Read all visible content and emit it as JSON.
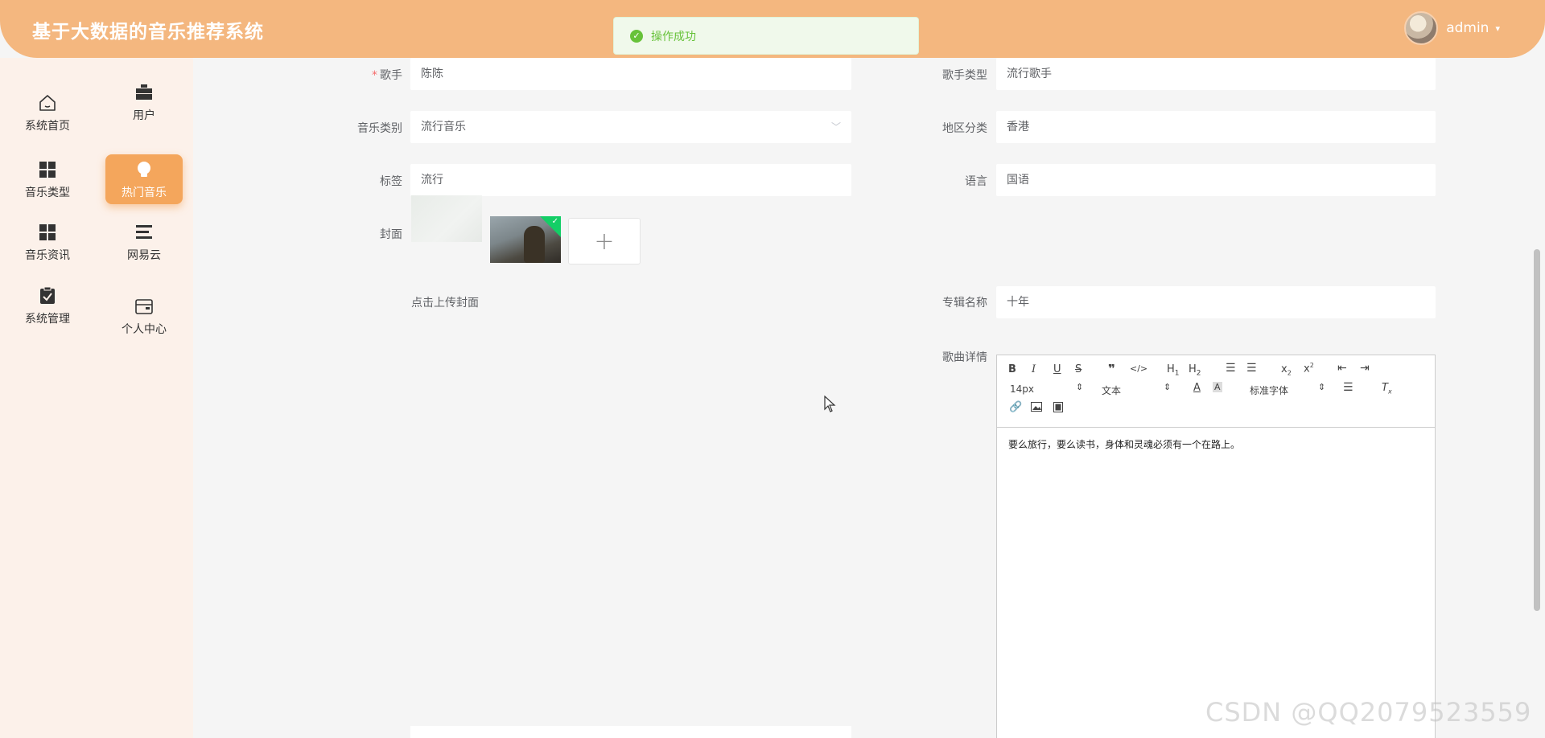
{
  "header": {
    "title": "基于大数据的音乐推荐系统",
    "username": "admin",
    "caret": "▾"
  },
  "toast": {
    "message": "操作成功"
  },
  "sidebar": {
    "items": [
      {
        "label": "系统首页",
        "icon": "home-icon"
      },
      {
        "label": "用户",
        "icon": "briefcase-icon"
      },
      {
        "label": "音乐类型",
        "icon": "grid-icon"
      },
      {
        "label": "热门音乐",
        "icon": "bulb-icon"
      },
      {
        "label": "音乐资讯",
        "icon": "grid-icon"
      },
      {
        "label": "网易云",
        "icon": "list-icon"
      },
      {
        "label": "系统管理",
        "icon": "clipboard-icon"
      },
      {
        "label": "个人中心",
        "icon": "wallet-icon"
      }
    ],
    "active": "热门音乐"
  },
  "form": {
    "singer": {
      "label": "歌手",
      "required": "*",
      "value": "陈陈"
    },
    "singer_type": {
      "label": "歌手类型",
      "value": "流行歌手"
    },
    "music_category": {
      "label": "音乐类别",
      "value": "流行音乐"
    },
    "region": {
      "label": "地区分类",
      "value": "香港"
    },
    "tags": {
      "label": "标签",
      "value": "流行"
    },
    "language": {
      "label": "语言",
      "value": "国语"
    },
    "cover": {
      "label": "封面",
      "upload_hint": "点击上传封面",
      "add": "+"
    },
    "album": {
      "label": "专辑名称",
      "value": "十年"
    },
    "details": {
      "label": "歌曲详情"
    }
  },
  "editor": {
    "font_size": "14px",
    "block_type": "文本",
    "font_family": "标准字体",
    "content": "要么旅行，要么读书，身体和灵魂必须有一个在路上。"
  },
  "watermark": "CSDN @QQ2079523559",
  "colors": {
    "header": "#f4b77f",
    "active_nav": "#f4a65c",
    "sidebar_bg": "#fcf1ea",
    "success": "#67c23a"
  }
}
